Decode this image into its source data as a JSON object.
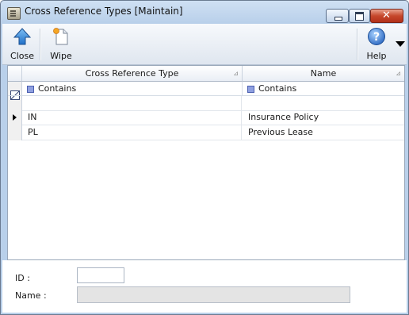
{
  "window": {
    "title": "Cross Reference Types [Maintain]",
    "minimize_glyph": "",
    "close_glyph": "✕"
  },
  "toolbar": {
    "close_label": "Close",
    "wipe_label": "Wipe",
    "help_label": "Help",
    "close_icon": "up-arrow-icon",
    "wipe_icon": "new-document-icon",
    "help_icon": "question-icon"
  },
  "grid": {
    "columns": [
      "Cross Reference Type",
      "Name"
    ],
    "filter": [
      "Contains",
      "Contains"
    ],
    "rows": [
      [
        "IN",
        "Insurance Policy"
      ],
      [
        "PL",
        "Previous Lease"
      ]
    ]
  },
  "form": {
    "id_label": "ID :",
    "name_label": "Name :",
    "id_value": "",
    "name_value": ""
  },
  "colors": {
    "titlebar": "#c7dbf1",
    "close_button": "#c6472c",
    "accent": "#3a72c4"
  }
}
